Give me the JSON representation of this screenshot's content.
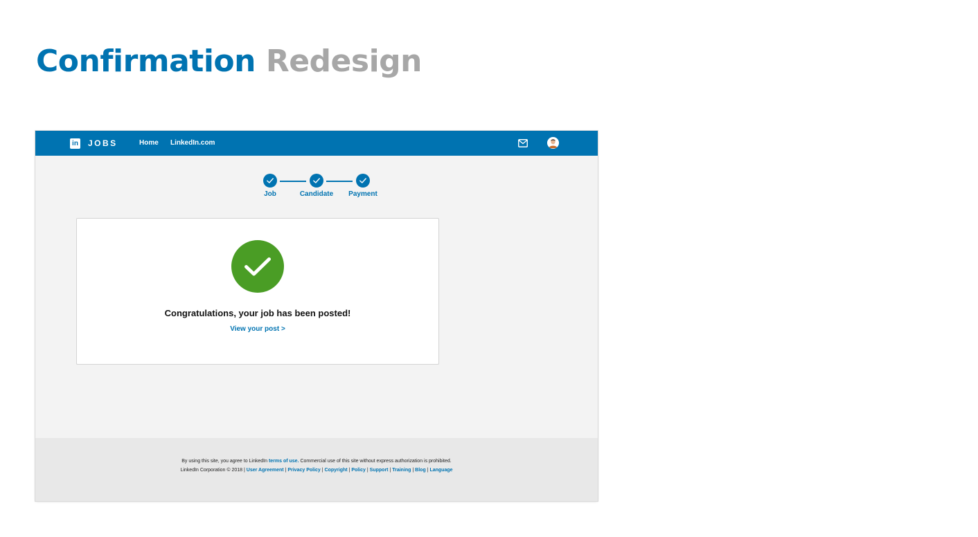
{
  "slide": {
    "title_primary": "Confirmation",
    "title_secondary": "Redesign"
  },
  "nav": {
    "logo_text": "in",
    "brand": "JOBS",
    "links": [
      "Home",
      "LinkedIn.com"
    ]
  },
  "stepper": {
    "steps": [
      {
        "label": "Job",
        "state": "complete"
      },
      {
        "label": "Candidate",
        "state": "complete"
      },
      {
        "label": "Payment",
        "state": "complete"
      }
    ]
  },
  "confirmation": {
    "message": "Congratulations, your job has been posted!",
    "link": "View your post >"
  },
  "footer": {
    "line1_prefix": "By using this site, you agree to LinkedIn ",
    "line1_link": "terms of use.",
    "line1_suffix": " Commercial use of this site without express authorization is prohibited.",
    "copyright": "LinkedIn Corporation © 2018 | ",
    "links": [
      "User Agreement",
      "Privacy Policy",
      "Copyright",
      "Policy",
      "Support",
      "Training",
      "Blog",
      "Language"
    ]
  },
  "colors": {
    "brand_blue": "#0073b1",
    "success_green": "#4a9d25",
    "title_gray": "#a7a7a7",
    "page_bg": "#f3f3f3",
    "footer_bg": "#e8e8e8"
  },
  "icons": [
    "linkedin-logo-icon",
    "mail-icon",
    "avatar",
    "check-icon"
  ]
}
